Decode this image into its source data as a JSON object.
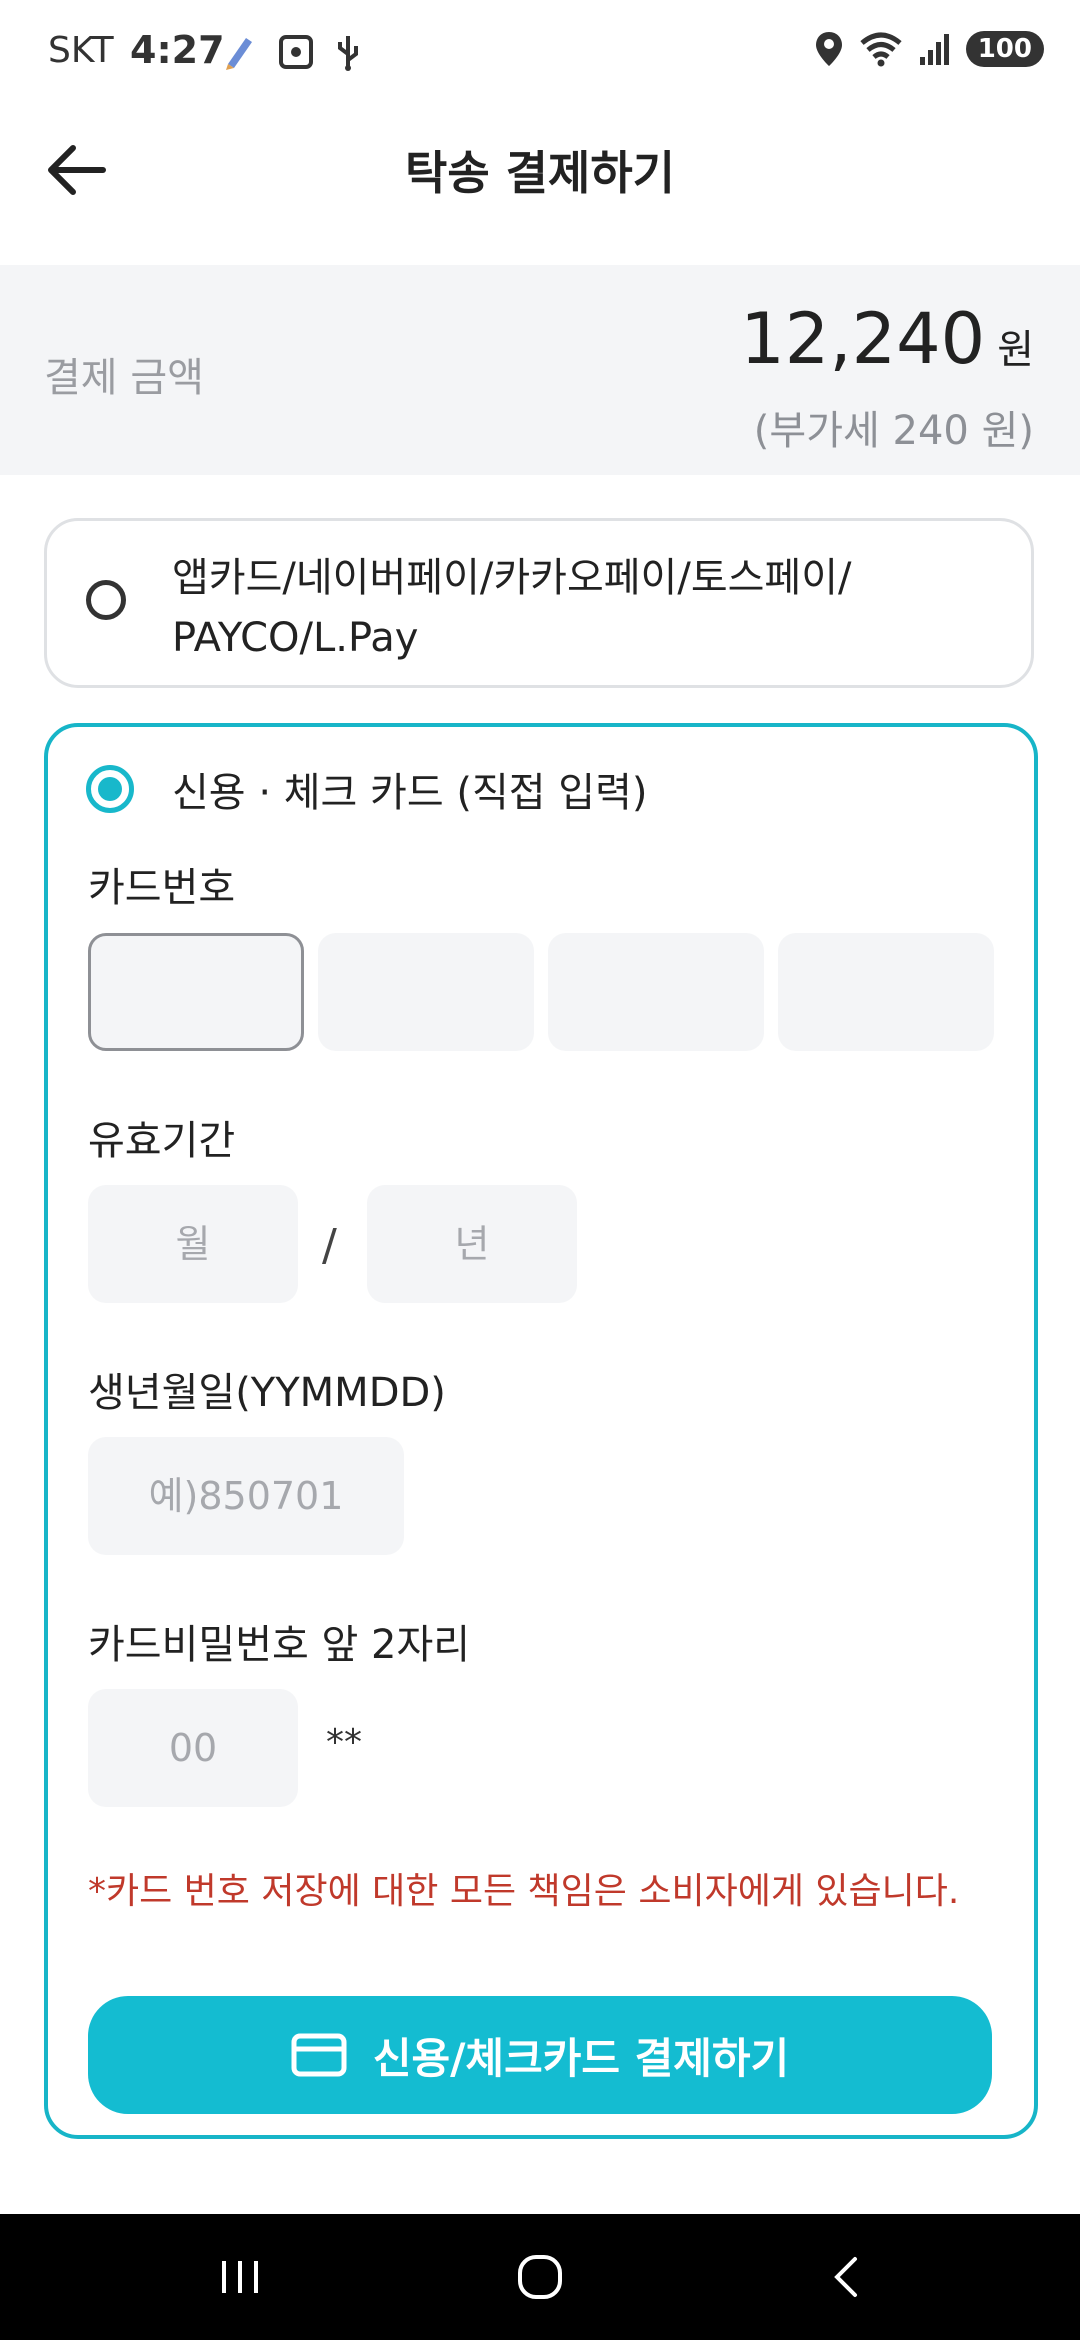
{
  "status_bar": {
    "carrier": "SKT",
    "time": "4:27",
    "battery": "100"
  },
  "header": {
    "title": "탁송 결제하기"
  },
  "amount": {
    "label": "결제 금액",
    "value": "12,240",
    "unit": "원",
    "vat_note": "(부가세 240 원)"
  },
  "option_1": {
    "line1": "앱카드/네이버페이/카카오페이/토스페이/",
    "line2": "PAYCO/L.Pay"
  },
  "option_2": {
    "label": "신용 · 체크 카드 (직접 입력)",
    "card_number_label": "카드번호",
    "expiry_label": "유효기간",
    "month_placeholder": "월",
    "year_placeholder": "년",
    "slash": "/",
    "birth_label": "생년월일(YYMMDD)",
    "birth_placeholder": "예)850701",
    "password_label": "카드비밀번호 앞 2자리",
    "password_placeholder": "00",
    "password_mask": "**",
    "warning": "*카드 번호 저장에 대한 모든 책임은 소비자에게 있습니다.",
    "pay_button": "신용/체크카드 결제하기"
  },
  "colors": {
    "accent": "#14bcd1",
    "warning": "#c0392b",
    "field_bg": "#f4f5f7"
  },
  "icons": {
    "back": "arrow-left-icon",
    "card": "credit-card-icon",
    "nav": [
      "recent-apps-icon",
      "home-icon",
      "back-icon"
    ]
  }
}
